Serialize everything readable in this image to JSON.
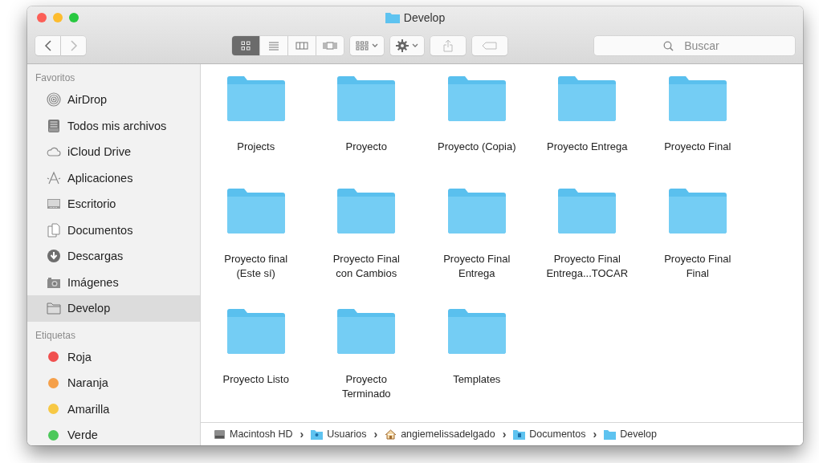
{
  "window": {
    "title": "Develop"
  },
  "toolbar": {
    "views": [
      {
        "selected": true
      },
      {
        "selected": false
      },
      {
        "selected": false
      },
      {
        "selected": false
      }
    ],
    "search": {
      "placeholder": "Buscar"
    }
  },
  "sidebar": {
    "sections": [
      {
        "title": "Favoritos",
        "items": [
          {
            "label": "AirDrop",
            "selected": false
          },
          {
            "label": "Todos mis archivos",
            "selected": false
          },
          {
            "label": "iCloud Drive",
            "selected": false
          },
          {
            "label": "Aplicaciones",
            "selected": false
          },
          {
            "label": "Escritorio",
            "selected": false
          },
          {
            "label": "Documentos",
            "selected": false
          },
          {
            "label": "Descargas",
            "selected": false
          },
          {
            "label": "Imágenes",
            "selected": false
          },
          {
            "label": "Develop",
            "selected": true
          }
        ]
      },
      {
        "title": "Etiquetas",
        "tags": [
          {
            "label": "Roja",
            "color": "#f0504f"
          },
          {
            "label": "Naranja",
            "color": "#f5a04a"
          },
          {
            "label": "Amarilla",
            "color": "#f7c844"
          },
          {
            "label": "Verde",
            "color": "#4cc85a"
          }
        ]
      }
    ]
  },
  "folders": [
    {
      "name": "Projects"
    },
    {
      "name": "Proyecto"
    },
    {
      "name": "Proyecto (Copia)"
    },
    {
      "name": "Proyecto Entrega"
    },
    {
      "name": "Proyecto Final"
    },
    {
      "name": "Proyecto final\n(Este sí)"
    },
    {
      "name": "Proyecto Final\ncon Cambios"
    },
    {
      "name": "Proyecto Final\nEntrega"
    },
    {
      "name": "Proyecto Final\nEntrega...TOCAR"
    },
    {
      "name": "Proyecto Final\nFinal"
    },
    {
      "name": "Proyecto Listo"
    },
    {
      "name": "Proyecto\nTerminado"
    },
    {
      "name": "Templates"
    }
  ],
  "path_bar": [
    {
      "label": "Macintosh HD",
      "separator": "›"
    },
    {
      "label": "Usuarios",
      "separator": "›"
    },
    {
      "label": "angiemelissadelgado",
      "separator": "›"
    },
    {
      "label": "Documentos",
      "separator": "›"
    },
    {
      "label": "Develop"
    }
  ]
}
